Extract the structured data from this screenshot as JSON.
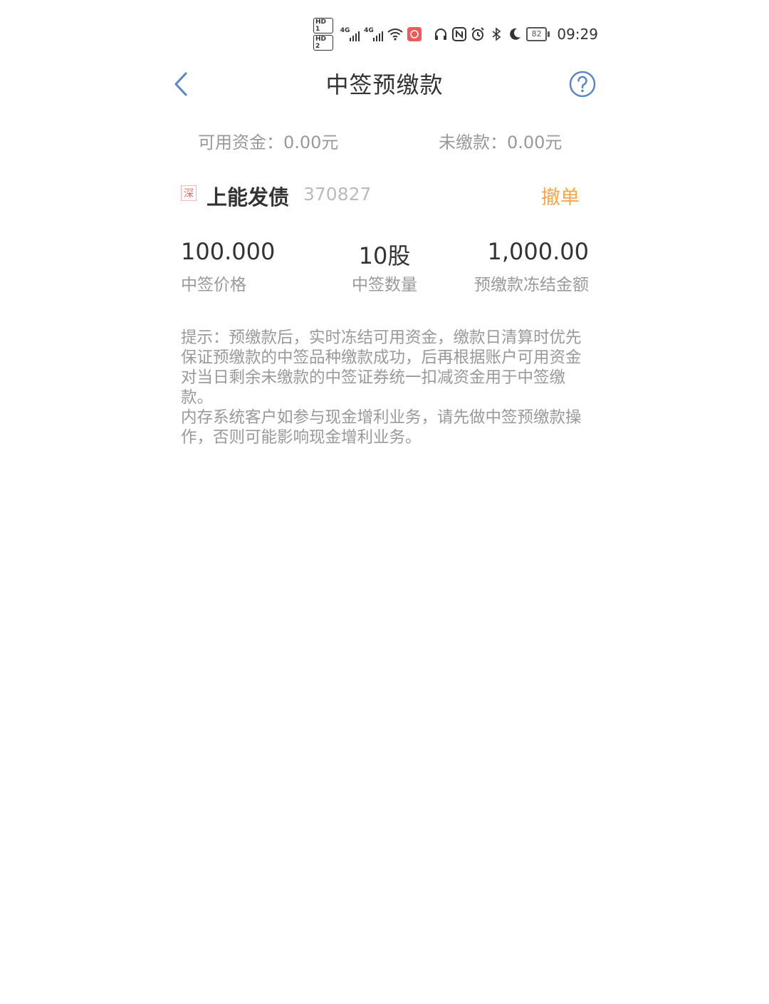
{
  "status_bar": {
    "hd1": "HD 1",
    "hd2": "HD 2",
    "network1": "4G",
    "network2": "4G",
    "battery": "82",
    "time": "09:29"
  },
  "header": {
    "title": "中签预缴款"
  },
  "summary": {
    "available": "可用资金：0.00元",
    "unpaid": "未缴款：0.00元"
  },
  "stock": {
    "market": "深",
    "name": "上能发债",
    "code": "370827",
    "cancel_label": "撤单"
  },
  "metrics": [
    {
      "value": "100.000",
      "label": "中签价格"
    },
    {
      "value": "10股",
      "label": "中签数量"
    },
    {
      "value": "1,000.00",
      "label": "预缴款冻结金额"
    }
  ],
  "tip": {
    "line1": "提示：预缴款后，实时冻结可用资金，缴款日清算时优先保证预缴款的中签品种缴款成功，后再根据账户可用资金对当日剩余未缴款的中签证券统一扣减资金用于中签缴款。",
    "line2": "内存系统客户如参与现金增利业务，请先做中签预缴款操作，否则可能影响现金增利业务。"
  },
  "colors": {
    "accent_blue": "#5b86c5",
    "cancel_orange": "#f5a84a",
    "market_tag_red": "#e26a6a"
  }
}
